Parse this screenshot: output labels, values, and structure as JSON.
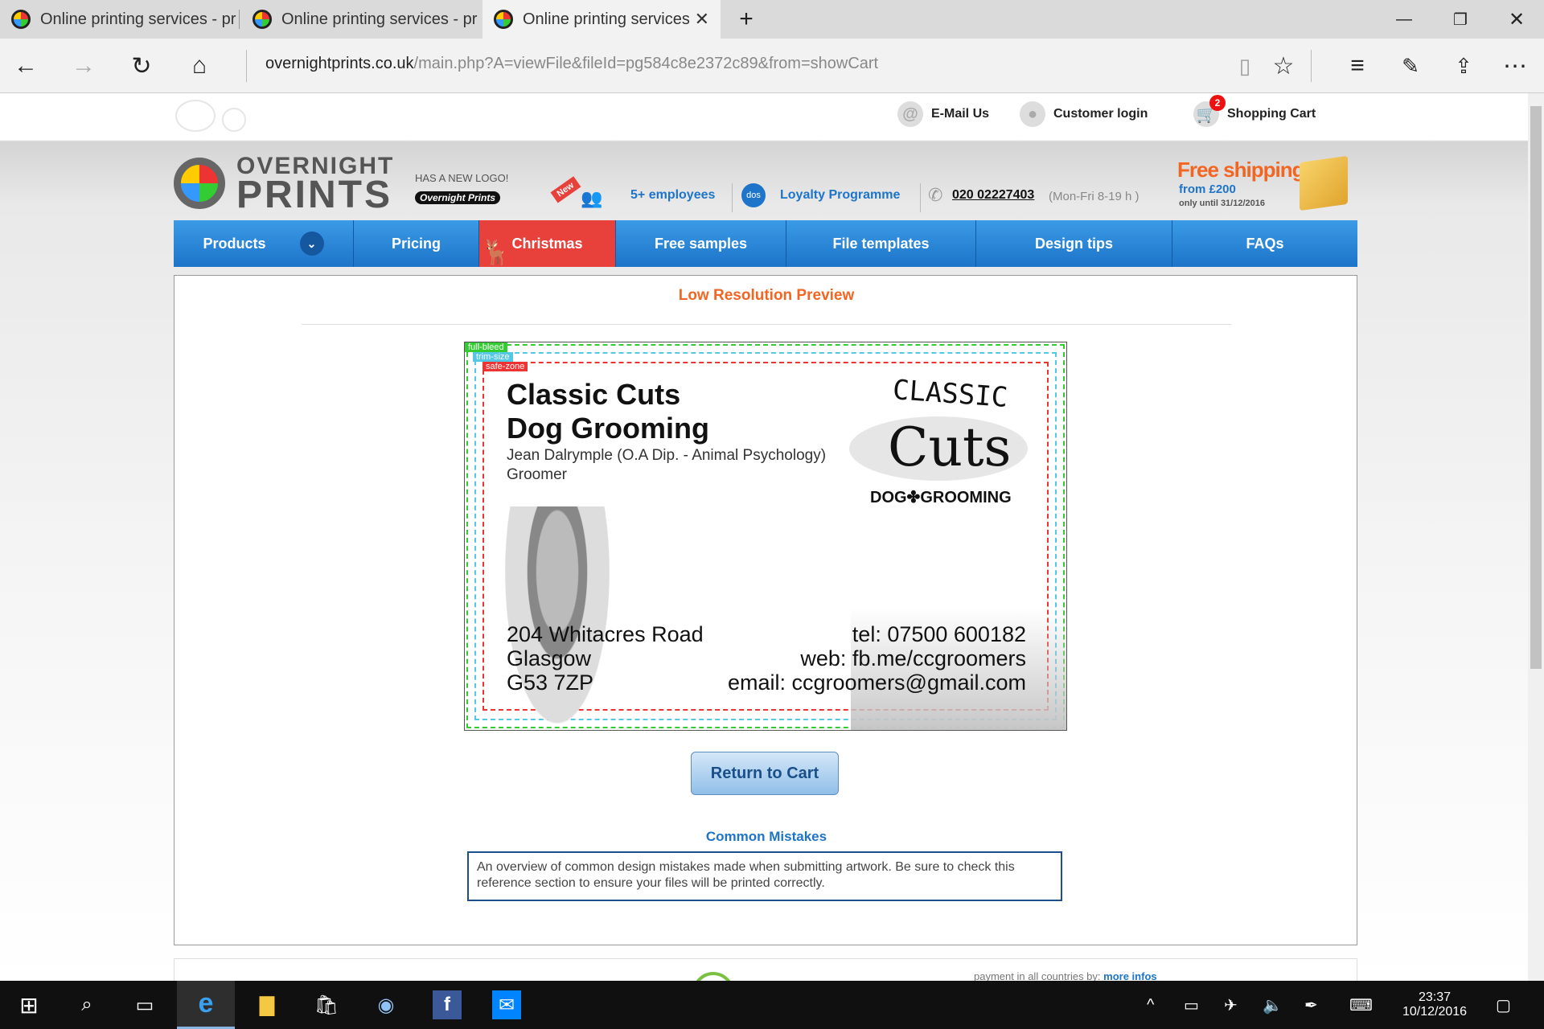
{
  "browser": {
    "tabs": [
      {
        "title": "Online printing services - pr"
      },
      {
        "title": "Online printing services - pr"
      },
      {
        "title": "Online printing services"
      }
    ],
    "url_domain": "overnightprints.co.uk",
    "url_path": "/main.php?A=viewFile&fileId=pg584c8e2372c89&from=showCart"
  },
  "header": {
    "email": "E-Mail Us",
    "login": "Customer login",
    "cart": "Shopping Cart",
    "cart_count": "2",
    "logo_top": "OVERNIGHT",
    "logo_bottom": "PRINTS",
    "new_logo": "HAS A NEW LOGO!",
    "new_logo_badge": "Overnight Prints",
    "new_badge": "New",
    "employees": "5+ employees",
    "loyalty_badge": "dos",
    "loyalty": "Loyalty Programme",
    "phone": "020 02227403",
    "hours": "(Mon-Fri 8-19 h )",
    "free_shipping": "Free shipping",
    "from": "from £200",
    "until": "only until 31/12/2016"
  },
  "nav": [
    "Products",
    "Pricing",
    "Christmas",
    "Free samples",
    "File templates",
    "Design tips",
    "FAQs"
  ],
  "content": {
    "heading": "Low Resolution Preview",
    "full_bleed": "full-bleed",
    "trim_size": "trim-size",
    "safe_zone": "safe-zone",
    "card": {
      "line1": "Classic Cuts",
      "line2": "Dog Grooming",
      "name": "Jean Dalrymple (O.A Dip. - Animal Psychology)",
      "role": "Groomer",
      "logo_top": "CLASSIC",
      "logo_mid": "Cuts",
      "logo_bottom": "DOG✤GROOMING",
      "addr1": "204 Whitacres Road",
      "addr2": "Glasgow",
      "addr3": "G53 7ZP",
      "tel": "tel: 07500 600182",
      "web": "web: fb.me/ccgroomers",
      "email": "email: ccgroomers@gmail.com"
    },
    "button": "Return to Cart",
    "mistakes_title": "Common Mistakes",
    "mistakes_text": "An overview of common design mistakes made when submitting artwork. Be sure to check this reference section to ensure your files will be printed correctly.",
    "footer_partial": "payment in all countries by:",
    "footer_link": "more infos"
  },
  "taskbar": {
    "time": "23:37",
    "date": "10/12/2016"
  },
  "colors": {
    "nav_blue": "#1d74c9",
    "christmas_red": "#e8413b",
    "heading_orange": "#f26522",
    "link_blue": "#1d74c9"
  }
}
